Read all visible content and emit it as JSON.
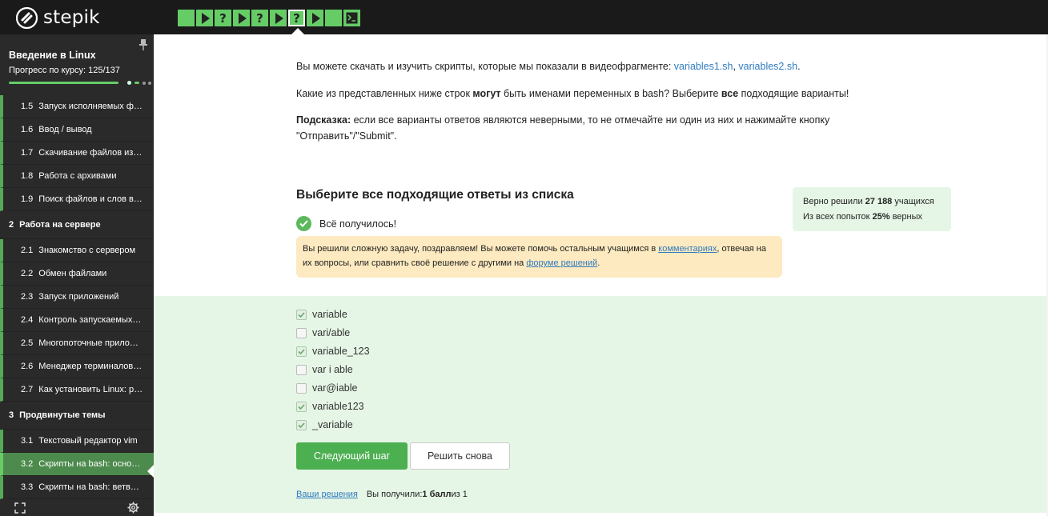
{
  "header": {
    "logo_text": "stepik",
    "steps": [
      {
        "type": "done",
        "icon": "empty"
      },
      {
        "type": "video",
        "icon": "play-icon"
      },
      {
        "type": "quiz",
        "icon": "question-icon",
        "label": "?"
      },
      {
        "type": "video",
        "icon": "play-icon"
      },
      {
        "type": "quiz",
        "icon": "question-icon",
        "label": "?"
      },
      {
        "type": "video",
        "icon": "play-icon"
      },
      {
        "type": "quiz",
        "icon": "question-icon",
        "label": "?",
        "current": true
      },
      {
        "type": "video",
        "icon": "play-icon"
      },
      {
        "type": "done",
        "icon": "empty"
      },
      {
        "type": "code",
        "icon": "terminal-icon"
      }
    ],
    "accent": "#66cc66"
  },
  "sidebar": {
    "course_title": "Введение в Linux",
    "progress_label": "Прогресс по курсу:",
    "progress_value": "125/137",
    "items": [
      {
        "kind": "lesson",
        "num": "1.5",
        "label": "Запуск исполняемых ф…"
      },
      {
        "kind": "lesson",
        "num": "1.6",
        "label": "Ввод / вывод"
      },
      {
        "kind": "lesson",
        "num": "1.7",
        "label": "Скачивание файлов из…"
      },
      {
        "kind": "lesson",
        "num": "1.8",
        "label": "Работа с архивами"
      },
      {
        "kind": "lesson",
        "num": "1.9",
        "label": "Поиск файлов и слов в…"
      },
      {
        "kind": "section",
        "num": "2",
        "label": "Работа на сервере"
      },
      {
        "kind": "lesson",
        "num": "2.1",
        "label": "Знакомство с сервером"
      },
      {
        "kind": "lesson",
        "num": "2.2",
        "label": "Обмен файлами"
      },
      {
        "kind": "lesson",
        "num": "2.3",
        "label": "Запуск приложений"
      },
      {
        "kind": "lesson",
        "num": "2.4",
        "label": "Контроль запускаемых…"
      },
      {
        "kind": "lesson",
        "num": "2.5",
        "label": "Многопоточные прило…"
      },
      {
        "kind": "lesson",
        "num": "2.6",
        "label": "Менеджер терминалов…"
      },
      {
        "kind": "lesson",
        "num": "2.7",
        "label": "Как установить Linux: р…"
      },
      {
        "kind": "section",
        "num": "3",
        "label": "Продвинутые темы"
      },
      {
        "kind": "lesson",
        "num": "3.1",
        "label": "Текстовый редактор vim"
      },
      {
        "kind": "lesson",
        "num": "3.2",
        "label": "Скрипты на bash: осно…",
        "active": true
      },
      {
        "kind": "lesson",
        "num": "3.3",
        "label": "Скрипты на bash: ветв…"
      }
    ]
  },
  "main": {
    "intro_text": "Вы можете скачать и изучить скрипты, которые мы показали в видеофрагменте: ",
    "link1": "variables1.sh",
    "comma": ", ",
    "link2": "variables2.sh",
    "period": ".",
    "question_a": "Какие из представленных ниже строк ",
    "question_bold1": "могут",
    "question_b": " быть именами переменных в bash? Выберите ",
    "question_bold2": "все",
    "question_c": " подходящие варианты!",
    "hint_bold": "Подсказка:",
    "hint_text": " если все варианты ответов являются неверными, то не отмечайте ни один из них и нажимайте кнопку \"Отправить\"/\"Submit\".",
    "quiz_title": "Выберите все подходящие ответы из списка",
    "success_text": "Всё получилось!",
    "notice_a": "Вы решили сложную задачу, поздравляем! Вы можете помочь остальным учащимся в ",
    "notice_link1": "комментариях",
    "notice_b": ", отвечая на их вопросы, или сравнить своё решение с другими на ",
    "notice_link2": "форуме решений",
    "notice_c": ".",
    "stats_line1_a": "Верно решили ",
    "stats_line1_bold": "27 188",
    "stats_line1_b": " учащихся",
    "stats_line2_a": "Из всех попыток ",
    "stats_line2_bold": "25%",
    "stats_line2_b": " верных",
    "options": [
      {
        "label": "variable",
        "checked": true
      },
      {
        "label": "vari/able",
        "checked": false
      },
      {
        "label": "variable_123",
        "checked": true
      },
      {
        "label": "var i able",
        "checked": false
      },
      {
        "label": "var@iable",
        "checked": false
      },
      {
        "label": "variable123",
        "checked": true
      },
      {
        "label": "_variable",
        "checked": true
      }
    ],
    "next_button": "Следующий шаг",
    "retry_button": "Решить снова",
    "your_solutions": "Ваши решения",
    "score_a": "Вы получили: ",
    "score_bold": "1 балл",
    "score_b": " из 1"
  }
}
